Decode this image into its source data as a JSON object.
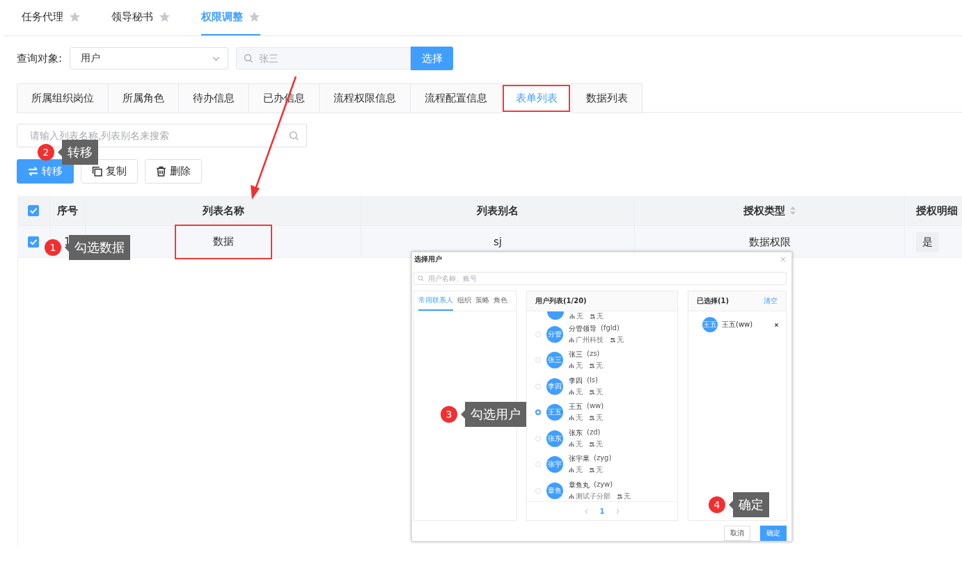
{
  "top_tabs": [
    {
      "label": "任务代理",
      "selected": false
    },
    {
      "label": "领导秘书",
      "selected": false
    },
    {
      "label": "权限调整",
      "selected": true
    }
  ],
  "query": {
    "label": "查询对象:",
    "select_value": "用户",
    "search_placeholder": "张三",
    "button": "选择"
  },
  "section_tabs": [
    {
      "label": "所属组织岗位",
      "selected": false,
      "highlighted": false
    },
    {
      "label": "所属角色",
      "selected": false,
      "highlighted": false
    },
    {
      "label": "待办信息",
      "selected": false,
      "highlighted": false
    },
    {
      "label": "已办信息",
      "selected": false,
      "highlighted": false
    },
    {
      "label": "流程权限信息",
      "selected": false,
      "highlighted": false
    },
    {
      "label": "流程配置信息",
      "selected": false,
      "highlighted": false
    },
    {
      "label": "表单列表",
      "selected": true,
      "highlighted": true
    },
    {
      "label": "数据列表",
      "selected": false,
      "highlighted": false
    }
  ],
  "list_search": {
    "placeholder": "请输入列表名称,列表别名来搜索"
  },
  "actions": [
    {
      "kind": "transfer",
      "label": "转移",
      "primary": true
    },
    {
      "kind": "copy",
      "label": "复制",
      "primary": false
    },
    {
      "kind": "delete",
      "label": "删除",
      "primary": false
    }
  ],
  "table": {
    "all_checked": true,
    "columns": [
      {
        "label": "序号",
        "sortable": false
      },
      {
        "label": "列表名称",
        "sortable": false
      },
      {
        "label": "列表别名",
        "sortable": false
      },
      {
        "label": "授权类型",
        "sortable": true
      },
      {
        "label": "授权明细"
      }
    ],
    "rows": [
      {
        "checked": true,
        "cells": [
          {
            "text": "1",
            "highlighted": false
          },
          {
            "text": "数据",
            "highlighted": true
          },
          {
            "text": "sj",
            "highlighted": false
          },
          {
            "text": "数据权限",
            "highlighted": false
          },
          {
            "text": "是",
            "highlighted": false
          }
        ]
      }
    ]
  },
  "dialog": {
    "title": "选择用户",
    "search_placeholder": "用户名称、账号",
    "source_tabs": [
      {
        "label": "常用联系人",
        "selected": true
      },
      {
        "label": "组织",
        "selected": false
      },
      {
        "label": "策略",
        "selected": false
      },
      {
        "label": "角色",
        "selected": false
      }
    ],
    "list_title": "用户列表(1/20)",
    "users": [
      {
        "kind": "partial",
        "org": "无",
        "role": "无"
      },
      {
        "kind": "full",
        "avatar": "分管",
        "name": "分管领导",
        "account": "(fgld)",
        "org": "广州科技",
        "role": "无",
        "selected": false
      },
      {
        "kind": "full",
        "avatar": "张三",
        "name": "张三",
        "account": "(zs)",
        "org": "无",
        "role": "无",
        "selected": false
      },
      {
        "kind": "full",
        "avatar": "李四",
        "name": "李四",
        "account": "(ls)",
        "org": "无",
        "role": "无",
        "selected": false
      },
      {
        "kind": "full",
        "avatar": "王五",
        "name": "王五",
        "account": "(ww)",
        "org": "无",
        "role": "无",
        "selected": true
      },
      {
        "kind": "full",
        "avatar": "张东",
        "name": "张东",
        "account": "(zd)",
        "org": "无",
        "role": "无",
        "selected": false
      },
      {
        "kind": "full",
        "avatar": "张宇",
        "name": "张宇果",
        "account": "(zyg)",
        "org": "无",
        "role": "无",
        "selected": false
      },
      {
        "kind": "full",
        "avatar": "章鱼",
        "name": "章鱼丸",
        "account": "(zyw)",
        "org": "测试子分部",
        "role": "无",
        "selected": false
      }
    ],
    "page": "1",
    "selected_title": "已选择(1)",
    "clear": "清空",
    "chosen": [
      {
        "avatar": "王五",
        "name": "王五(ww)"
      }
    ],
    "buttons": [
      {
        "kind": "cancel",
        "label": "取消"
      },
      {
        "kind": "confirm",
        "label": "确定"
      }
    ]
  },
  "callouts": [
    {
      "number": "2",
      "text": "转移"
    },
    {
      "number": "1",
      "text": "勾选数据"
    },
    {
      "number": "3",
      "text": "勾选用户"
    },
    {
      "number": "4",
      "text": "确定"
    }
  ]
}
